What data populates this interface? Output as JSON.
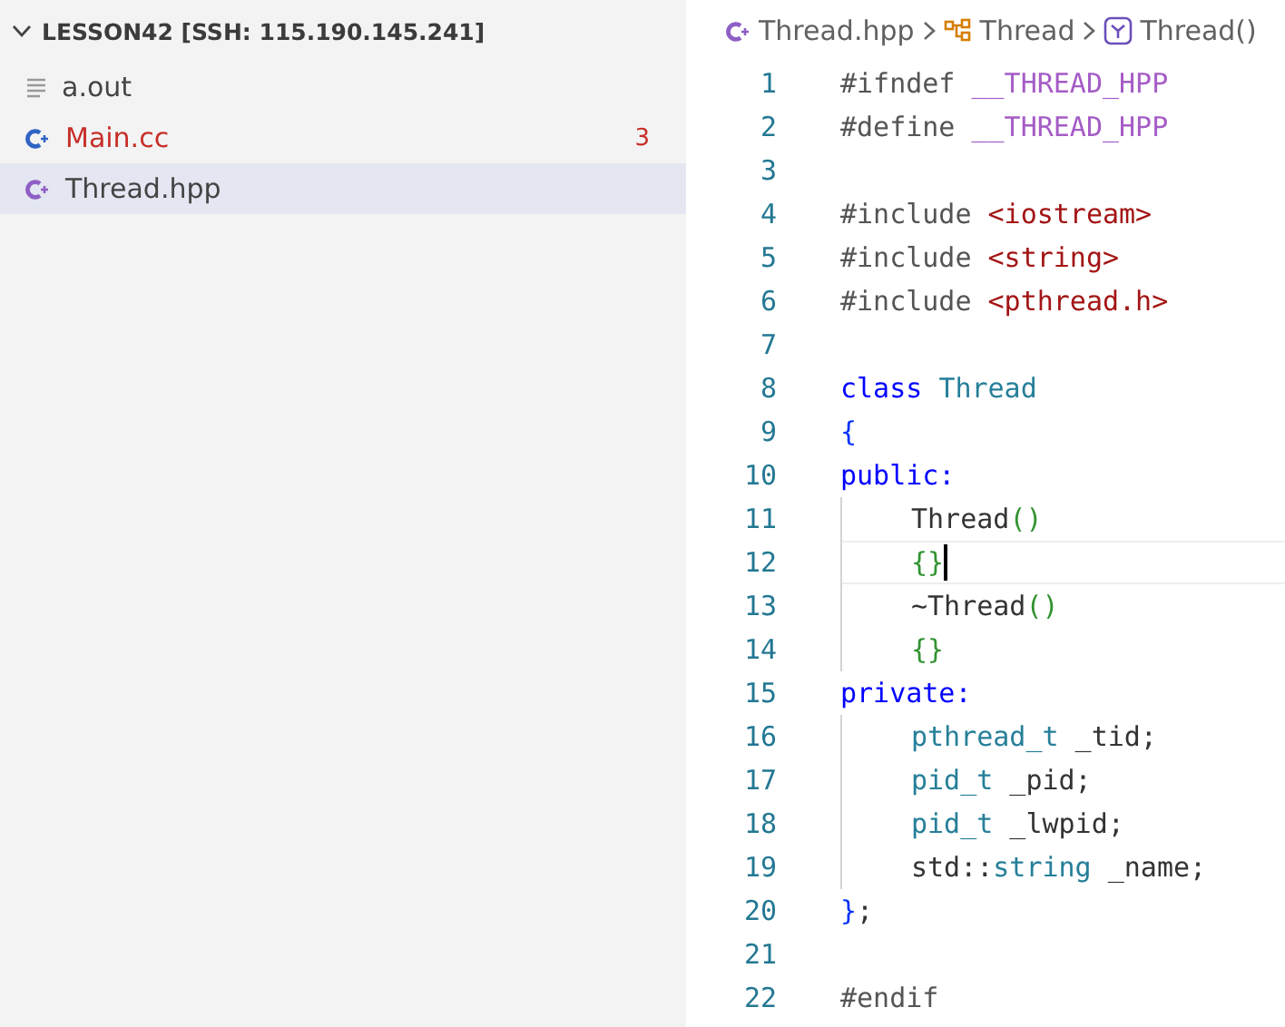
{
  "explorer": {
    "title": "LESSON42 [SSH: 115.190.145.241]",
    "expanded": true,
    "files": [
      {
        "name": "a.out",
        "kind": "text",
        "error": false,
        "selected": false
      },
      {
        "name": "Main.cc",
        "kind": "cpp",
        "error": true,
        "problems": "3",
        "selected": false
      },
      {
        "name": "Thread.hpp",
        "kind": "hpp",
        "error": false,
        "selected": true
      }
    ]
  },
  "breadcrumbs": [
    {
      "label": "Thread.hpp",
      "kind": "file"
    },
    {
      "label": "Thread",
      "kind": "class"
    },
    {
      "label": "Thread()",
      "kind": "method"
    }
  ],
  "editor": {
    "lines": [
      {
        "number": "1",
        "guide": false,
        "current": false,
        "tokens": [
          {
            "text": "#ifndef ",
            "kind": "directive"
          },
          {
            "text": "__THREAD_HPP",
            "kind": "macro"
          }
        ]
      },
      {
        "number": "2",
        "guide": false,
        "current": false,
        "tokens": [
          {
            "text": "#define ",
            "kind": "directive"
          },
          {
            "text": "__THREAD_HPP",
            "kind": "macro"
          }
        ]
      },
      {
        "number": "3",
        "guide": false,
        "current": false
      },
      {
        "number": "4",
        "guide": false,
        "current": false,
        "tokens": [
          {
            "text": "#include ",
            "kind": "directive"
          },
          {
            "text": "<iostream>",
            "kind": "header"
          }
        ]
      },
      {
        "number": "5",
        "guide": false,
        "current": false,
        "tokens": [
          {
            "text": "#include ",
            "kind": "directive"
          },
          {
            "text": "<string>",
            "kind": "header"
          }
        ]
      },
      {
        "number": "6",
        "guide": false,
        "current": false,
        "tokens": [
          {
            "text": "#include ",
            "kind": "directive"
          },
          {
            "text": "<pthread.h>",
            "kind": "header"
          }
        ]
      },
      {
        "number": "7",
        "guide": false,
        "current": false
      },
      {
        "number": "8",
        "guide": false,
        "current": false,
        "tokens": [
          {
            "text": "class ",
            "kind": "keyword"
          },
          {
            "text": "Thread",
            "kind": "type"
          }
        ]
      },
      {
        "number": "9",
        "guide": false,
        "current": false,
        "tokens": [
          {
            "text": "{",
            "kind": "bracket1"
          }
        ]
      },
      {
        "number": "10",
        "guide": false,
        "current": false,
        "tokens": [
          {
            "text": "public:",
            "kind": "keyword"
          }
        ]
      },
      {
        "number": "11",
        "guide": true,
        "current": false,
        "tokens": [
          {
            "text": "Thread",
            "kind": "plain"
          },
          {
            "text": "()",
            "kind": "bracket2"
          }
        ]
      },
      {
        "number": "12",
        "guide": true,
        "current": true,
        "tokens": [
          {
            "text": "{}",
            "kind": "bracket2"
          }
        ]
      },
      {
        "number": "13",
        "guide": true,
        "current": false,
        "tokens": [
          {
            "text": "~Thread",
            "kind": "plain"
          },
          {
            "text": "()",
            "kind": "bracket2"
          }
        ]
      },
      {
        "number": "14",
        "guide": true,
        "current": false,
        "tokens": [
          {
            "text": "{}",
            "kind": "bracket2"
          }
        ]
      },
      {
        "number": "15",
        "guide": false,
        "current": false,
        "tokens": [
          {
            "text": "private:",
            "kind": "keyword"
          }
        ]
      },
      {
        "number": "16",
        "guide": true,
        "current": false,
        "tokens": [
          {
            "text": "pthread_t",
            "kind": "type"
          },
          {
            "text": " _tid;",
            "kind": "plain"
          }
        ]
      },
      {
        "number": "17",
        "guide": true,
        "current": false,
        "tokens": [
          {
            "text": "pid_t",
            "kind": "type"
          },
          {
            "text": " _pid;",
            "kind": "plain"
          }
        ]
      },
      {
        "number": "18",
        "guide": true,
        "current": false,
        "tokens": [
          {
            "text": "pid_t",
            "kind": "type"
          },
          {
            "text": " _lwpid;",
            "kind": "plain"
          }
        ]
      },
      {
        "number": "19",
        "guide": true,
        "current": false,
        "tokens": [
          {
            "text": "std::",
            "kind": "plain"
          },
          {
            "text": "string",
            "kind": "type"
          },
          {
            "text": " _name;",
            "kind": "plain"
          }
        ]
      },
      {
        "number": "20",
        "guide": false,
        "current": false,
        "tokens": [
          {
            "text": "}",
            "kind": "bracket1"
          },
          {
            "text": ";",
            "kind": "plain"
          }
        ]
      },
      {
        "number": "21",
        "guide": false,
        "current": false
      },
      {
        "number": "22",
        "guide": false,
        "current": false,
        "tokens": [
          {
            "text": "#endif",
            "kind": "directive"
          }
        ]
      }
    ]
  }
}
